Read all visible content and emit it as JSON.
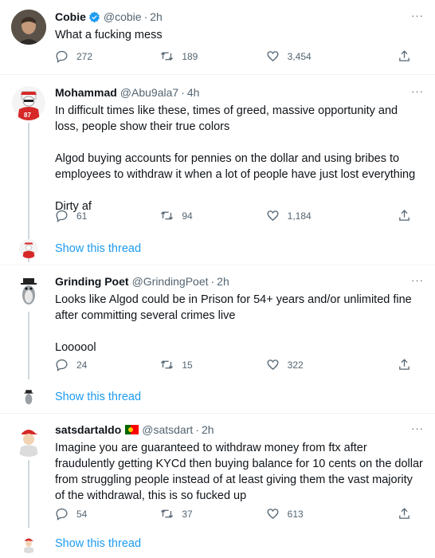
{
  "tweets": [
    {
      "name": "Cobie",
      "handle": "@cobie",
      "time": "2h",
      "text": "What a fucking mess",
      "replies": "272",
      "retweets": "189",
      "likes": "3,454",
      "verified": true
    },
    {
      "name": "Mohammad",
      "handle": "@Abu9ala7",
      "time": "4h",
      "text": "In difficult times like these, times of greed, massive opportunity and loss, people show their true colors\n\nAlgod buying accounts for pennies on the dollar and using bribes to employees to withdraw it when a lot of people have just lost everything\n\nDirty af",
      "replies": "61",
      "retweets": "94",
      "likes": "1,184",
      "show_thread": "Show this thread"
    },
    {
      "name": "Grinding Poet",
      "handle": "@GrindingPoet",
      "time": "2h",
      "text": "Looks like Algod could be in Prison for 54+ years and/or unlimited fine after committing several crimes live\n\nLoooool",
      "replies": "24",
      "retweets": "15",
      "likes": "322",
      "show_thread": "Show this thread"
    },
    {
      "name": "satsdartaldo",
      "handle": "@satsdart",
      "time": "2h",
      "text": "Imagine you are guaranteed to withdraw money from ftx after fraudulently getting KYCd then buying balance for 10 cents on the dollar from struggling people instead of at least giving them the vast majority of the withdrawal, this is so fucked up",
      "replies": "54",
      "retweets": "37",
      "likes": "613",
      "show_thread": "Show this thread",
      "flag_colors": [
        "#006600",
        "#ff0000",
        "#ffcc00"
      ]
    }
  ],
  "more_icon": "···",
  "dot": "·",
  "colors": {
    "link": "#1d9bf0",
    "secondary": "#536471",
    "verified": "#1d9bf0"
  }
}
